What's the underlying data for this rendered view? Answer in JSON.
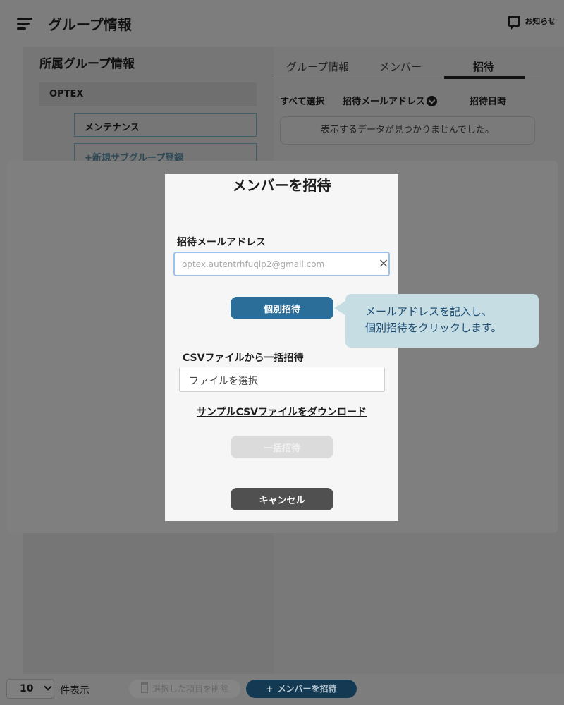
{
  "header": {
    "title": "グループ情報",
    "notice_label": "お知らせ"
  },
  "sidebar": {
    "section_title": "所属グループ情報",
    "root_group": "OPTEX",
    "subgroups": [
      "メンテナンス",
      "+新規サブグループ登録"
    ]
  },
  "tabs": [
    {
      "label": "グループ情報",
      "active": false
    },
    {
      "label": "メンバー",
      "active": false
    },
    {
      "label": "招待",
      "active": true
    }
  ],
  "table": {
    "columns": [
      "すべて選択",
      "招待メールアドレス",
      "招待日時"
    ],
    "empty_message": "表示するデータが見つかりませんでした。"
  },
  "modal": {
    "title": "メンバーを招待",
    "email_label": "招待メールアドレス",
    "email_value": "optex.autentrhfuqlp2@gmail.com",
    "invite_button": "個別招待",
    "csv_label": "CSVファイルから一括招待",
    "file_placeholder": "ファイルを選択",
    "sample_link": "サンプルCSVファイルをダウンロード",
    "bulk_button": "一括招待",
    "cancel_button": "キャンセル"
  },
  "callout": {
    "line1": "メールアドレスを記入し、",
    "line2": "個別招待をクリックします。"
  },
  "footer": {
    "per_page_value": "10",
    "per_page_label": "件表示",
    "delete_button": "選択した項目を削除",
    "add_member_button": "メンバーを招待"
  },
  "colors": {
    "primary": "#2b6e99",
    "callout_bg": "#c5dde3",
    "callout_text": "#1f4f77",
    "cancel": "#505050"
  }
}
